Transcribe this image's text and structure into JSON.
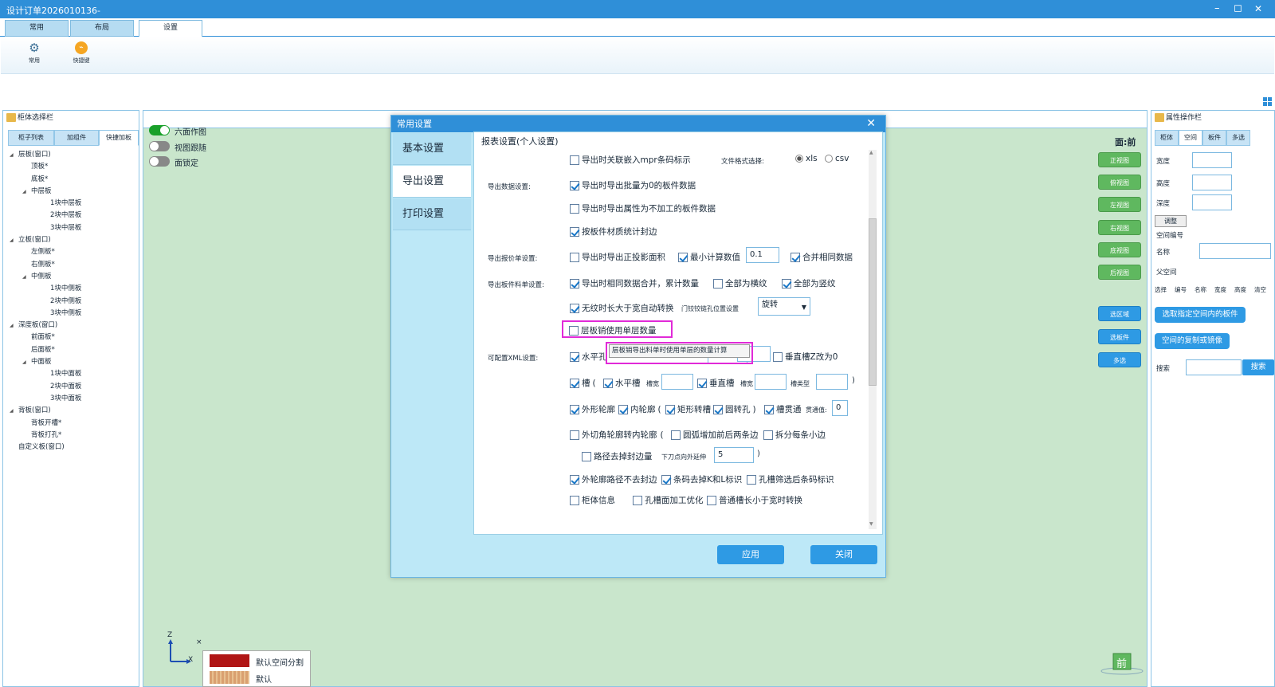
{
  "window": {
    "title": "设计订单2026010136-",
    "minimize": "–",
    "maximize": "◻",
    "close": "✕"
  },
  "tabs": [
    {
      "label": "常用"
    },
    {
      "label": "布局"
    },
    {
      "label": "设置"
    }
  ],
  "ribbon": [
    {
      "label": "常用",
      "icon": "gear-icon"
    },
    {
      "label": "快捷键",
      "icon": "shortcut-icon"
    }
  ],
  "left_panel": {
    "title": "柜体选择栏",
    "tabs": [
      "柜子列表",
      "加组件",
      "快捷加板"
    ],
    "tree": [
      {
        "label": "层板(窗口)",
        "level": 0,
        "exp": "◢"
      },
      {
        "label": "顶板*",
        "level": 1,
        "exp": ""
      },
      {
        "label": "底板*",
        "level": 1,
        "exp": ""
      },
      {
        "label": "中层板",
        "level": 1,
        "exp": "◢"
      },
      {
        "label": "1块中层板",
        "level": 2,
        "exp": ""
      },
      {
        "label": "2块中层板",
        "level": 2,
        "exp": ""
      },
      {
        "label": "3块中层板",
        "level": 2,
        "exp": ""
      },
      {
        "label": "立板(窗口)",
        "level": 0,
        "exp": "◢"
      },
      {
        "label": "左侧板*",
        "level": 1,
        "exp": ""
      },
      {
        "label": "右侧板*",
        "level": 1,
        "exp": ""
      },
      {
        "label": "中侧板",
        "level": 1,
        "exp": "◢"
      },
      {
        "label": "1块中侧板",
        "level": 2,
        "exp": ""
      },
      {
        "label": "2块中侧板",
        "level": 2,
        "exp": ""
      },
      {
        "label": "3块中侧板",
        "level": 2,
        "exp": ""
      },
      {
        "label": "深度板(窗口)",
        "level": 0,
        "exp": "◢"
      },
      {
        "label": "前面板*",
        "level": 1,
        "exp": ""
      },
      {
        "label": "后面板*",
        "level": 1,
        "exp": ""
      },
      {
        "label": "中面板",
        "level": 1,
        "exp": "◢"
      },
      {
        "label": "1块中面板",
        "level": 2,
        "exp": ""
      },
      {
        "label": "2块中面板",
        "level": 2,
        "exp": ""
      },
      {
        "label": "3块中面板",
        "level": 2,
        "exp": ""
      },
      {
        "label": "背板(窗口)",
        "level": 0,
        "exp": "◢"
      },
      {
        "label": "背板开槽*",
        "level": 1,
        "exp": ""
      },
      {
        "label": "背板打孔*",
        "level": 1,
        "exp": ""
      },
      {
        "label": "自定义板(窗口)",
        "level": 0,
        "exp": ""
      }
    ]
  },
  "canvas": {
    "toggles": [
      {
        "label": "六面作图",
        "on": true
      },
      {
        "label": "视图跟随",
        "on": false
      },
      {
        "label": "面锁定",
        "on": false
      }
    ],
    "face_label": "面:前",
    "view_buttons": [
      "正视图",
      "俯视图",
      "左视图",
      "右视图",
      "底视图",
      "后视图"
    ],
    "select_buttons": [
      "选区域",
      "选板件",
      "多选"
    ],
    "axes": {
      "z": "Z",
      "x": "X"
    },
    "legend": [
      {
        "label": "默认空间分割",
        "color": "#b01515"
      },
      {
        "label": "默认",
        "color": "#d9a070"
      }
    ],
    "nav_cube_label": "前"
  },
  "right_panel": {
    "title": "属性操作栏",
    "tabs": [
      "柜体",
      "空间",
      "板件",
      "多选"
    ],
    "fields": [
      {
        "label": "宽度",
        "value": ""
      },
      {
        "label": "高度",
        "value": ""
      },
      {
        "label": "深度",
        "value": ""
      }
    ],
    "adjust_button": "调整",
    "space_no_label": "空间编号",
    "name_label": "名称",
    "name_value": "",
    "parent_label": "父空间",
    "table_headers": [
      "选择",
      "编号",
      "名称",
      "宽度",
      "高度",
      "清空"
    ],
    "btn_select_boards": "选取指定空间内的板件",
    "btn_copy_mirror": "空间的复制或镜像",
    "search_label": "搜索",
    "search_value": "",
    "search_button": "搜索"
  },
  "dialog": {
    "title": "常用设置",
    "close": "✕",
    "nav": [
      "基本设置",
      "导出设置",
      "打印设置"
    ],
    "section_title": "报表设置(个人设置)",
    "labels": {
      "export_data": "导出数据设置:",
      "quote": "导出报价单设置:",
      "material": "导出板件料单设置:",
      "xml": "可配置XML设置:",
      "file_format": "文件格式选择:",
      "door_hinge": "门铰铰链孔位置设置",
      "slot_width1": "槽宽",
      "slot_width2": "槽宽",
      "slot_type": "槽类型",
      "through": "贯通值:",
      "lead_out": "下刀点向外延伸"
    },
    "cb": {
      "mpr": "导出时关联嵌入mpr条码标示",
      "zero": "导出时导出批量为0的板件数据",
      "noproc": "导出时导出属性为不加工的板件数据",
      "edge": "按板件材质统计封边",
      "proj": "导出时导出正投影面积",
      "minval": "最小计算数值",
      "merge": "合并相同数据",
      "same": "导出时相同数据合并，累计数量",
      "allh": "全部为横纹",
      "allv": "全部为竖纹",
      "grain": "无纹时长大于宽自动转换",
      "shelf": "层板销使用单层数量",
      "hhole": "水平孔",
      "zslot": "垂直槽Z改为0",
      "slot": "槽",
      "hslot": "水平槽",
      "vslot": "垂直槽",
      "outline": "外形轮廓",
      "inner": "内轮廓",
      "rect": "矩形转槽",
      "round": "圆转孔",
      "thru": "槽贯通",
      "chamfer": "外切角轮廓转内轮廓",
      "arc": "圆弧增加前后两条边",
      "split": "拆分每条小边",
      "path": "路径去掉封边量",
      "keep": "外轮廓路径不去封边",
      "barcode": "条码去掉K和L标识",
      "filter": "孔槽筛选后条码标识",
      "cab": "柜体信息",
      "opt": "孔槽面加工优化",
      "conv": "普通槽长小于宽时转换"
    },
    "radio": {
      "xls": "xls",
      "csv": "csv"
    },
    "values": {
      "min_value": "0.1",
      "hinge": "旋转",
      "through": "0",
      "lead_out": "5"
    },
    "tooltip": "层板销导出料单时使用单层的数量计算",
    "apply": "应用",
    "close_btn": "关闭"
  },
  "colors": {
    "accent": "#2f8fd8",
    "highlight": "#e12ad8",
    "canvas": "#c9e6cc",
    "green_btn": "#5fb85f"
  }
}
